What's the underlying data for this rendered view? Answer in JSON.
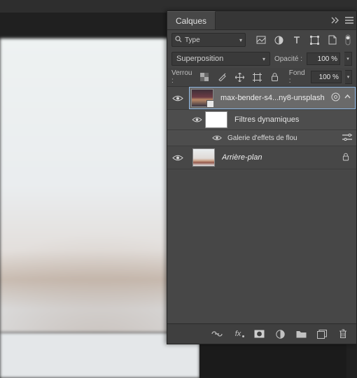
{
  "panel": {
    "tab_label": "Calques",
    "filter": {
      "type_label": "Type"
    },
    "blend_mode": "Superposition",
    "opacity_label": "Opacité :",
    "opacity_value": "100 %",
    "lock_label": "Verrou :",
    "fill_label": "Fond :",
    "fill_value": "100 %"
  },
  "layers": {
    "smart": {
      "name": "max-bender-s4...ny8-unsplash",
      "filters_label": "Filtres dynamiques",
      "effect_label": "Galerie d'effets de flou"
    },
    "background": {
      "name": "Arrière-plan"
    }
  }
}
